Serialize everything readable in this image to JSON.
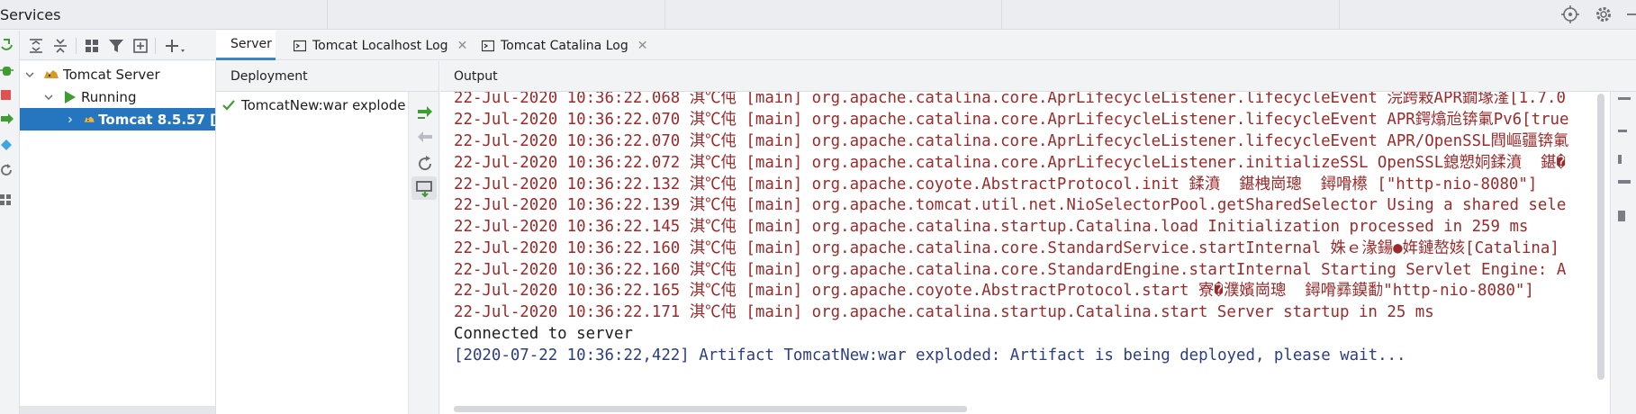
{
  "window": {
    "title": "Services"
  },
  "icons": {
    "target": "crosshair-icon",
    "settings": "gear-icon",
    "minimize": "minimize-icon"
  },
  "tree": {
    "items": [
      {
        "label": "Tomcat Server",
        "icon": "tomcat-icon"
      },
      {
        "label": "Running",
        "icon": "run-icon"
      },
      {
        "label": "Tomcat 8.5.57 [",
        "icon": "tomcat-icon"
      }
    ]
  },
  "tabs": [
    {
      "label": "Server"
    },
    {
      "label": "Tomcat Localhost Log"
    },
    {
      "label": "Tomcat Catalina Log"
    }
  ],
  "deployment": {
    "header": "Deployment",
    "items": [
      {
        "label": "TomcatNew:war explode"
      }
    ]
  },
  "output": {
    "header": "Output",
    "lines": [
      "22-Jul-2020 10:36:22.068 淇℃伅 [main] org.apache.catalina.core.AprLifecycleListener.lifecycleEvent 浣跨敤APR鐗堟湰[1.7.0",
      "22-Jul-2020 10:36:22.070 淇℃伅 [main] org.apache.catalina.core.AprLifecycleListener.lifecycleEvent APR鍔熻兘锛氭Pv6[true",
      "22-Jul-2020 10:36:22.070 淇℃伅 [main] org.apache.catalina.core.AprLifecycleListener.lifecycleEvent APR/OpenSSL閰嶇疆锛氭",
      "22-Jul-2020 10:36:22.072 淇℃伅 [main] org.apache.catalina.core.AprLifecycleListener.initializeSSL OpenSSL鎴愬姛鍒濆  鍖�",
      "22-Jul-2020 10:36:22.132 淇℃伅 [main] org.apache.coyote.AbstractProtocol.init 鍒濆  鍖栧崗璁  鐞嗗櫒 [\"http-nio-8080\"]",
      "22-Jul-2020 10:36:22.139 淇℃伅 [main] org.apache.tomcat.util.net.NioSelectorPool.getSharedSelector Using a shared sele",
      "22-Jul-2020 10:36:22.145 淇℃伅 [main] org.apache.catalina.startup.Catalina.load Initialization processed in 259 ms",
      "22-Jul-2020 10:36:22.160 淇℃伅 [main] org.apache.catalina.core.StandardService.startInternal 姝ｅ湪鍚●姩鏈嶅姟[Catalina]",
      "22-Jul-2020 10:36:22.160 淇℃伅 [main] org.apache.catalina.core.StandardEngine.startInternal Starting Servlet Engine: A",
      "22-Jul-2020 10:36:22.165 淇℃伅 [main] org.apache.coyote.AbstractProtocol.start 寮�濮嬪崗璁  鐞嗗彞鏌勫\"http-nio-8080\"]",
      "22-Jul-2020 10:36:22.171 淇℃伅 [main] org.apache.catalina.startup.Catalina.start Server startup in 25 ms",
      "Connected to server",
      "[2020-07-22 10:36:22,422] Artifact TomcatNew:war exploded: Artifact is being deployed, please wait..."
    ]
  },
  "colors": {
    "error_text": "#9c2a2a",
    "system_text": "#2b3d84",
    "selection": "#2675bf",
    "run_green": "#3f9c35"
  }
}
